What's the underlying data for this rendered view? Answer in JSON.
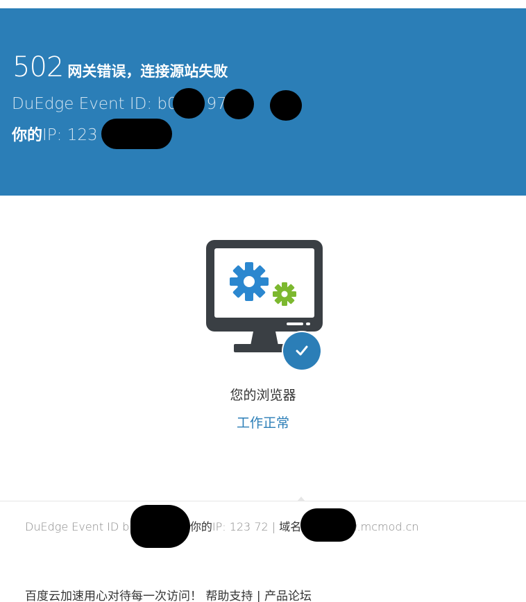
{
  "banner": {
    "error_code": "502",
    "error_message": "网关错误，连接源站失败",
    "event_id_text": "DuEdge Event ID: b0      dc    97   0",
    "ip_label": "你的",
    "ip_value": "IP: 123          .72",
    "background_color": "#2b7eb7"
  },
  "status": {
    "browser_label": "您的浏览器",
    "browser_status": "工作正常",
    "accent_color": "#2b7eb7",
    "icon": "monitor-gears-icon",
    "badge_icon": "check-circle-icon"
  },
  "footer": {
    "event_id_text": "DuEdge Event ID b0        972f50 | ",
    "ip_label": "你的",
    "ip_value": "IP: 123          72 | ",
    "domain_label": "域名信息",
    "domain_value": ": www.mcmod.cn",
    "slogan": "百度云加速用心对待每一次访问！",
    "help_link": "帮助支持",
    "separator": "|",
    "forum_link": "产品论坛"
  }
}
